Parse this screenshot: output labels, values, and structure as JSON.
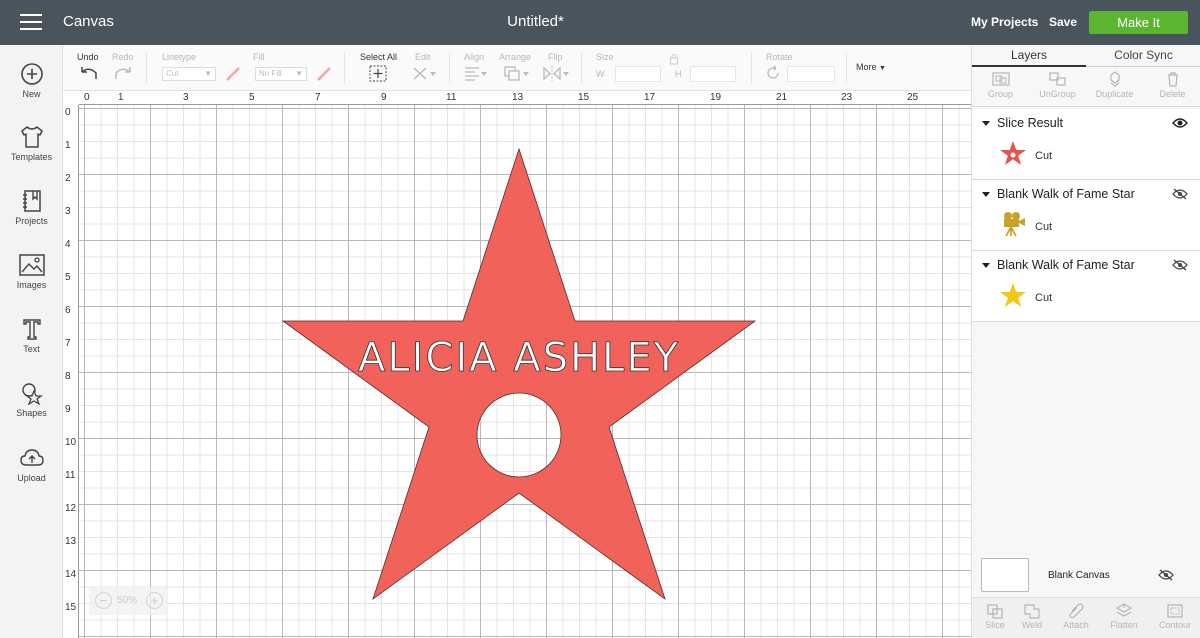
{
  "header": {
    "app_title": "Canvas",
    "doc_title": "Untitled*",
    "my_projects": "My Projects",
    "save": "Save",
    "make_it": "Make It",
    "make_it_color": "#5bb531",
    "bar_color": "#4a545c"
  },
  "sidebar": {
    "items": [
      {
        "label": "New",
        "icon": "plus-circle-icon"
      },
      {
        "label": "Templates",
        "icon": "tshirt-icon"
      },
      {
        "label": "Projects",
        "icon": "notebook-icon"
      },
      {
        "label": "Images",
        "icon": "image-icon"
      },
      {
        "label": "Text",
        "icon": "text-t-icon"
      },
      {
        "label": "Shapes",
        "icon": "shapes-icon"
      },
      {
        "label": "Upload",
        "icon": "cloud-upload-icon"
      }
    ]
  },
  "toolbar": {
    "undo": "Undo",
    "redo": "Redo",
    "linetype": "Linetype",
    "linetype_value": "Cut",
    "fill": "Fill",
    "fill_value": "No Fill",
    "select_all": "Select All",
    "edit": "Edit",
    "align": "Align",
    "arrange": "Arrange",
    "flip": "Flip",
    "size": "Size",
    "size_w": "W",
    "size_h": "H",
    "rotate": "Rotate",
    "more": "More"
  },
  "canvas": {
    "ruler_top": [
      "0",
      "1",
      "3",
      "5",
      "7",
      "9",
      "11",
      "13",
      "15",
      "17",
      "19",
      "21",
      "23",
      "25"
    ],
    "ruler_left": [
      "0",
      "1",
      "2",
      "3",
      "4",
      "5",
      "6",
      "7",
      "8",
      "9",
      "10",
      "11",
      "12",
      "13",
      "14",
      "15"
    ],
    "star_text": "ALICIA  ASHLEY",
    "star_color": "#f0625a",
    "zoom": "50%"
  },
  "layers_panel": {
    "tabs": [
      "Layers",
      "Color Sync"
    ],
    "actions": [
      "Group",
      "UnGroup",
      "Duplicate",
      "Delete"
    ],
    "groups": [
      {
        "name": "Slice Result",
        "op": "Cut",
        "thumb_color": "#e9524e",
        "visible": true
      },
      {
        "name": "Blank Walk of Fame Star",
        "op": "Cut",
        "thumb_color": "#c9a227",
        "visible": false
      },
      {
        "name": "Blank Walk of Fame Star",
        "op": "Cut",
        "thumb_color": "#f5c518",
        "visible": false
      }
    ],
    "blank_canvas": "Blank Canvas",
    "bottom_actions": [
      "Slice",
      "Weld",
      "Attach",
      "Flatten",
      "Contour"
    ]
  }
}
